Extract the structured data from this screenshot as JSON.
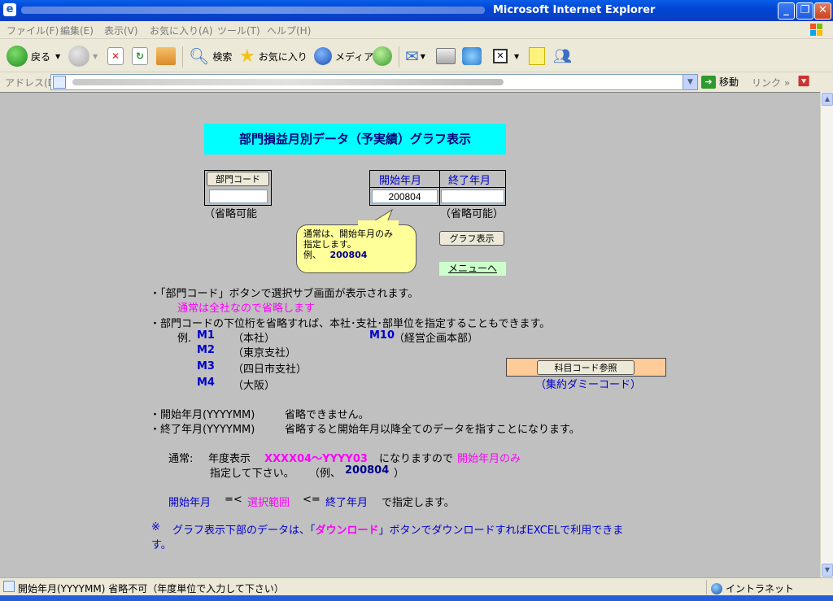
{
  "window": {
    "title": "Microsoft Internet Explorer",
    "minimize": "_",
    "maximize": "❐",
    "close": "✕"
  },
  "menu": [
    "ファイル(F)",
    "編集(E)",
    "表示(V)",
    "お気に入り(A)",
    "ツール(T)",
    "ヘルプ(H)"
  ],
  "toolbar": {
    "back": "戻る",
    "search": "検索",
    "favorites": "お気に入り",
    "media": "メディア"
  },
  "address": {
    "label": "アドレス(D)",
    "go": "移動",
    "links": "リンク"
  },
  "page": {
    "title": "部門損益月別データ（予実績）グラフ表示",
    "dept_button": "部門コード",
    "dept_value": "",
    "dept_note": "（省略可能",
    "start_header": "開始年月",
    "end_header": "終了年月",
    "start_value": "200804",
    "end_value": "",
    "end_note": "（省略可能）",
    "callout_line1": "通常は、開始年月のみ",
    "callout_line2": "指定します。",
    "callout_ex_label": "例、",
    "callout_ex_value": "200804",
    "graph_button": "グラフ表示",
    "menu_link": "メニューへ",
    "bullet1": "・「部門コード」ボタンで選択サブ画面が表示されます。",
    "bullet1_note": "通常は全社なので省略します",
    "bullet2": "・部門コードの下位桁を省略すれば、本社･支社･部単位を指定することもできます。",
    "ex_label": "例.",
    "examples": [
      {
        "code": "M1",
        "name": "（本社）"
      },
      {
        "code": "M2",
        "name": "（東京支社）"
      },
      {
        "code": "M3",
        "name": "（四日市支社）"
      },
      {
        "code": "M4",
        "name": "（大阪）"
      }
    ],
    "ex_m10_code": "M10",
    "ex_m10_name": "（経営企画本部）",
    "subject_button": "科目コード参照",
    "subject_note": "（集約ダミーコード）",
    "bullet3_a": "・開始年月(YYYYMM)",
    "bullet3_b": "省略できません。",
    "bullet4_a": "・終了年月(YYYYMM)",
    "bullet4_b": "省略すると開始年月以降全てのデータを指すことになります。",
    "normal_label": "通常:",
    "normal_text1": "年度表示",
    "normal_range": "XXXX04〜YYYY03",
    "normal_text2": "になりますので",
    "normal_highlight": "開始年月のみ",
    "normal_line2": "指定して下さい。",
    "normal_ex_open": "（例、",
    "normal_ex_value": "200804",
    "normal_ex_close": "）",
    "range_start": "開始年月",
    "range_op1": "=<",
    "range_mid": "選択範囲",
    "range_op2": "<=",
    "range_end": "終了年月",
    "range_tail": "で指定します。",
    "note_mark": "※",
    "note_text_a": "グラフ表示下部のデータは、「",
    "note_text_b": "ダウンロード",
    "note_text_c": "」ボタンでダウンロードすればEXCELで利用できま",
    "note_text_d": "す。"
  },
  "status": {
    "text": "開始年月(YYYYMM)  省略不可（年度単位で入力して下さい）",
    "zone": "イントラネット"
  }
}
